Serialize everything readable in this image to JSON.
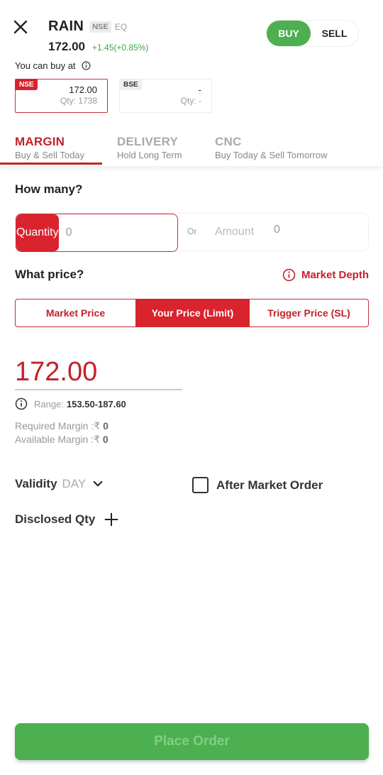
{
  "header": {
    "symbol": "RAIN",
    "exchange_badge": "NSE",
    "series": "EQ",
    "ltp": "172.00",
    "change": "+1.45(+0.85%)",
    "buy_at_label": "You can buy at"
  },
  "side_toggle": {
    "buy_label": "BUY",
    "sell_label": "SELL",
    "selected": "BUY"
  },
  "exchanges": [
    {
      "tag": "NSE",
      "price": "172.00",
      "qty": "Qty: 1738",
      "selected": true
    },
    {
      "tag": "BSE",
      "price": "-",
      "qty": "Qty: -",
      "selected": false
    }
  ],
  "product_tabs": [
    {
      "title": "MARGIN",
      "subtitle": "Buy & Sell Today",
      "active": true
    },
    {
      "title": "DELIVERY",
      "subtitle": "Hold Long Term",
      "active": false
    },
    {
      "title": "CNC",
      "subtitle": "Buy Today & Sell Tomorrow",
      "active": false
    }
  ],
  "how_many": {
    "title": "How many?",
    "quantity_label": "Quantity",
    "quantity_value": "0",
    "or_label": "Or",
    "amount_label": "Amount",
    "amount_value": "0"
  },
  "what_price": {
    "title": "What price?",
    "market_depth_label": "Market Depth",
    "options": [
      "Market Price",
      "Your Price (Limit)",
      "Trigger Price (SL)"
    ],
    "selected": "Your Price (Limit)",
    "price_value": "172.00",
    "range_label": "Range:",
    "range_value": "153.50-187.60"
  },
  "margins": {
    "required_label": "Required Margin :₹",
    "required_value": "0",
    "available_label": "Available Margin :₹",
    "available_value": "0"
  },
  "validity": {
    "label": "Validity",
    "value": "DAY"
  },
  "after_market_order": {
    "label": "After Market Order",
    "checked": false
  },
  "disclosed_qty": {
    "label": "Disclosed Qty"
  },
  "place_order": {
    "label": "Place Order"
  },
  "colors": {
    "brand_red": "#d9232d",
    "buy_green": "#4caf50",
    "positive_change": "#3aa74a"
  }
}
